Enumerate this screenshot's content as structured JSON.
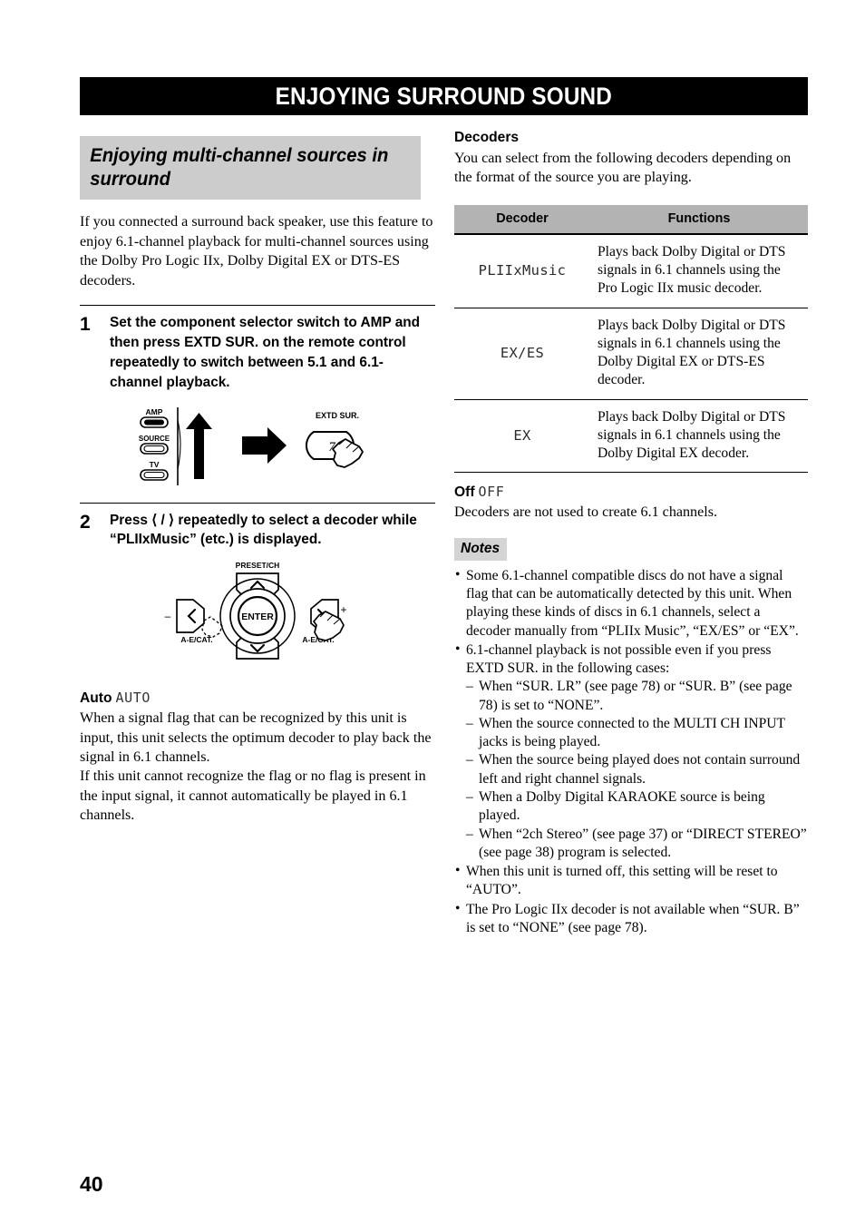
{
  "banner": {
    "title": "ENJOYING SURROUND SOUND"
  },
  "page": {
    "number": "40"
  },
  "left": {
    "section_heading": "Enjoying multi-channel sources in surround",
    "intro": "If you connected a surround back speaker, use this feature to enjoy 6.1-channel playback for multi-channel sources using the Dolby Pro Logic IIx, Dolby Digital EX or DTS-ES decoders.",
    "steps": [
      {
        "number": "1",
        "text": "Set the component selector switch to AMP and then press EXTD SUR. on the remote control repeatedly to switch between 5.1 and 6.1-channel playback."
      },
      {
        "number": "2",
        "text": "Press ⟨ / ⟩ repeatedly to select a decoder while “PLIIxMusic” (etc.) is displayed."
      }
    ],
    "figure1": {
      "switch_labels": [
        "AMP",
        "SOURCE",
        "TV"
      ],
      "selected": "AMP",
      "button_caption": "EXTD SUR.",
      "button_number": "7"
    },
    "figure2": {
      "top_label": "PRESET/CH",
      "center_label": "ENTER",
      "left_label": "A-E/CAT.",
      "right_label": "A-E/CAT.",
      "minus_label": "–",
      "plus_label": "+"
    },
    "auto": {
      "label": "Auto",
      "lcd": "AUTO",
      "para1": "When a signal flag that can be recognized by this unit is input, this unit selects the optimum decoder to play back the signal in 6.1 channels.",
      "para2": "If this unit cannot recognize the flag or no flag is present in the input signal, it cannot automatically be played in 6.1 channels."
    }
  },
  "right": {
    "decoders_heading": "Decoders",
    "decoders_intro": "You can select from the following decoders depending on the format of the source you are playing.",
    "table": {
      "headers": [
        "Decoder",
        "Functions"
      ],
      "rows": [
        {
          "decoder": "PLIIxMusic",
          "function": "Plays back Dolby Digital or DTS signals in 6.1 channels using the Pro Logic IIx music decoder."
        },
        {
          "decoder": "EX/ES",
          "function": "Plays back Dolby Digital or DTS signals in 6.1 channels using the Dolby Digital EX or DTS-ES decoder."
        },
        {
          "decoder": "EX",
          "function": "Plays back Dolby Digital or DTS signals in 6.1 channels using the Dolby Digital EX decoder."
        }
      ]
    },
    "off": {
      "label": "Off",
      "lcd": "OFF",
      "text": "Decoders are not used to create 6.1 channels."
    },
    "notes_label": "Notes",
    "notes": [
      {
        "text": "Some 6.1-channel compatible discs do not have a signal flag that can be automatically detected by this unit. When playing these kinds of discs in 6.1 channels, select a decoder manually from “PLIIx Music”, “EX/ES” or “EX”."
      },
      {
        "text": "6.1-channel playback is not possible even if you press EXTD SUR. in the following cases:",
        "sub": [
          "When “SUR. LR” (see page 78) or “SUR. B” (see page 78) is set to “NONE”.",
          "When the source connected to the MULTI CH INPUT jacks is being played.",
          "When the source being played does not contain surround left and right channel signals.",
          "When a Dolby Digital KARAOKE source is being played.",
          "When “2ch Stereo” (see page 37) or “DIRECT STEREO” (see page 38) program is selected."
        ]
      },
      {
        "text": "When this unit is turned off, this setting will be reset to “AUTO”."
      },
      {
        "text": "The Pro Logic IIx decoder is not available when “SUR. B” is set to “NONE” (see page 78)."
      }
    ]
  },
  "colors": {
    "banner_bg": "#000000",
    "section_heading_bg": "#cccccc",
    "table_header_bg": "#b3b3b3",
    "notes_label_bg": "#d4d4d4"
  }
}
